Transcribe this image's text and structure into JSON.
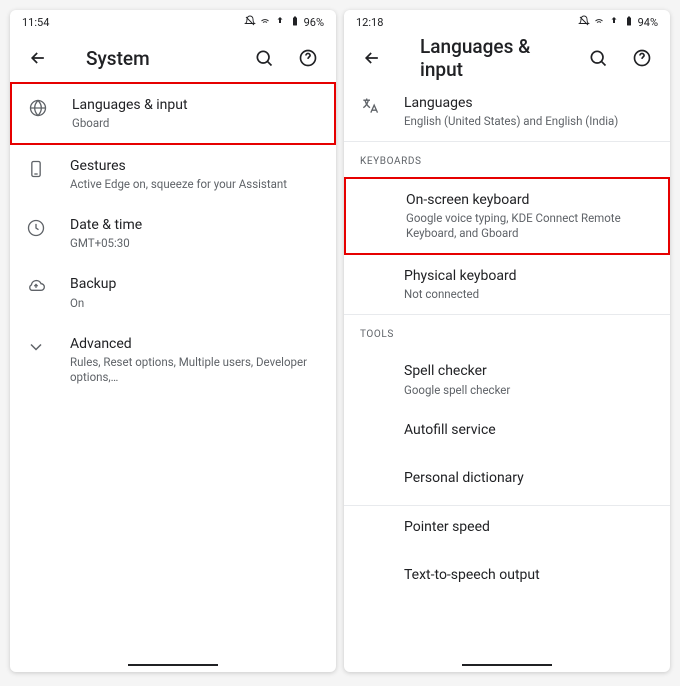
{
  "left": {
    "status": {
      "time": "11:54",
      "battery": "96%"
    },
    "title": "System",
    "rows": [
      {
        "icon": "globe-icon",
        "primary": "Languages & input",
        "secondary": "Gboard",
        "hl": true
      },
      {
        "icon": "phone-icon",
        "primary": "Gestures",
        "secondary": "Active Edge on, squeeze for your Assistant"
      },
      {
        "icon": "clock-icon",
        "primary": "Date & time",
        "secondary": "GMT+05:30"
      },
      {
        "icon": "cloud-icon",
        "primary": "Backup",
        "secondary": "On"
      },
      {
        "icon": "chevron-down-icon",
        "primary": "Advanced",
        "secondary": "Rules, Reset options, Multiple users, Developer options,…"
      }
    ]
  },
  "right": {
    "status": {
      "time": "12:18",
      "battery": "94%"
    },
    "title": "Languages & input",
    "languages": {
      "primary": "Languages",
      "secondary": "English (United States) and English (India)"
    },
    "section_keyboards": "KEYBOARDS",
    "onscreen": {
      "primary": "On-screen keyboard",
      "secondary": "Google voice typing, KDE Connect Remote Keyboard, and Gboard"
    },
    "physical": {
      "primary": "Physical keyboard",
      "secondary": "Not connected"
    },
    "section_tools": "TOOLS",
    "tools": [
      {
        "primary": "Spell checker",
        "secondary": "Google spell checker"
      },
      {
        "primary": "Autofill service"
      },
      {
        "primary": "Personal dictionary"
      },
      {
        "primary": "Pointer speed"
      },
      {
        "primary": "Text-to-speech output"
      }
    ]
  }
}
